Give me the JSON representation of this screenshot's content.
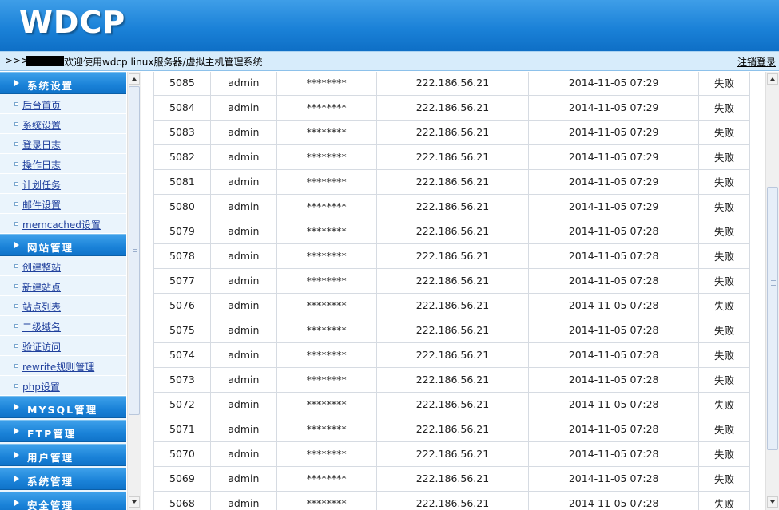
{
  "header": {
    "logo": "WDCP"
  },
  "topbar": {
    "prefix": ">>>",
    "welcome": "欢迎使用wdcp linux服务器/虚拟主机管理系统",
    "logout": "注销登录"
  },
  "sidebar": {
    "groups": [
      {
        "title": "系统设置",
        "items": [
          "后台首页",
          "系统设置",
          "登录日志",
          "操作日志",
          "计划任务",
          "邮件设置",
          "memcached设置"
        ]
      },
      {
        "title": "网站管理",
        "items": [
          "创建整站",
          "新建站点",
          "站点列表",
          "二级域名",
          "验证访问",
          "rewrite规则管理",
          "php设置"
        ]
      },
      {
        "title": "MYSQL管理",
        "items": []
      },
      {
        "title": "FTP管理",
        "items": []
      },
      {
        "title": "用户管理",
        "items": []
      },
      {
        "title": "系统管理",
        "items": []
      },
      {
        "title": "安全管理",
        "items": []
      }
    ]
  },
  "log_table": {
    "rows": [
      [
        "5085",
        "admin",
        "********",
        "222.186.56.21",
        "2014-11-05 07:29",
        "失败"
      ],
      [
        "5084",
        "admin",
        "********",
        "222.186.56.21",
        "2014-11-05 07:29",
        "失败"
      ],
      [
        "5083",
        "admin",
        "********",
        "222.186.56.21",
        "2014-11-05 07:29",
        "失败"
      ],
      [
        "5082",
        "admin",
        "********",
        "222.186.56.21",
        "2014-11-05 07:29",
        "失败"
      ],
      [
        "5081",
        "admin",
        "********",
        "222.186.56.21",
        "2014-11-05 07:29",
        "失败"
      ],
      [
        "5080",
        "admin",
        "********",
        "222.186.56.21",
        "2014-11-05 07:29",
        "失败"
      ],
      [
        "5079",
        "admin",
        "********",
        "222.186.56.21",
        "2014-11-05 07:28",
        "失败"
      ],
      [
        "5078",
        "admin",
        "********",
        "222.186.56.21",
        "2014-11-05 07:28",
        "失败"
      ],
      [
        "5077",
        "admin",
        "********",
        "222.186.56.21",
        "2014-11-05 07:28",
        "失败"
      ],
      [
        "5076",
        "admin",
        "********",
        "222.186.56.21",
        "2014-11-05 07:28",
        "失败"
      ],
      [
        "5075",
        "admin",
        "********",
        "222.186.56.21",
        "2014-11-05 07:28",
        "失败"
      ],
      [
        "5074",
        "admin",
        "********",
        "222.186.56.21",
        "2014-11-05 07:28",
        "失败"
      ],
      [
        "5073",
        "admin",
        "********",
        "222.186.56.21",
        "2014-11-05 07:28",
        "失败"
      ],
      [
        "5072",
        "admin",
        "********",
        "222.186.56.21",
        "2014-11-05 07:28",
        "失败"
      ],
      [
        "5071",
        "admin",
        "********",
        "222.186.56.21",
        "2014-11-05 07:28",
        "失败"
      ],
      [
        "5070",
        "admin",
        "********",
        "222.186.56.21",
        "2014-11-05 07:28",
        "失败"
      ],
      [
        "5069",
        "admin",
        "********",
        "222.186.56.21",
        "2014-11-05 07:28",
        "失败"
      ],
      [
        "5068",
        "admin",
        "********",
        "222.186.56.21",
        "2014-11-05 07:28",
        "失败"
      ]
    ]
  },
  "colors": {
    "header_blue": "#1b82d8",
    "topbar_bg": "#d7ecfb",
    "sidebar_bg": "#eaf4fc",
    "link": "#1f3f9c"
  },
  "icons": {
    "group_marker": "triangle-right-icon",
    "item_marker": "square-bullet-icon"
  }
}
